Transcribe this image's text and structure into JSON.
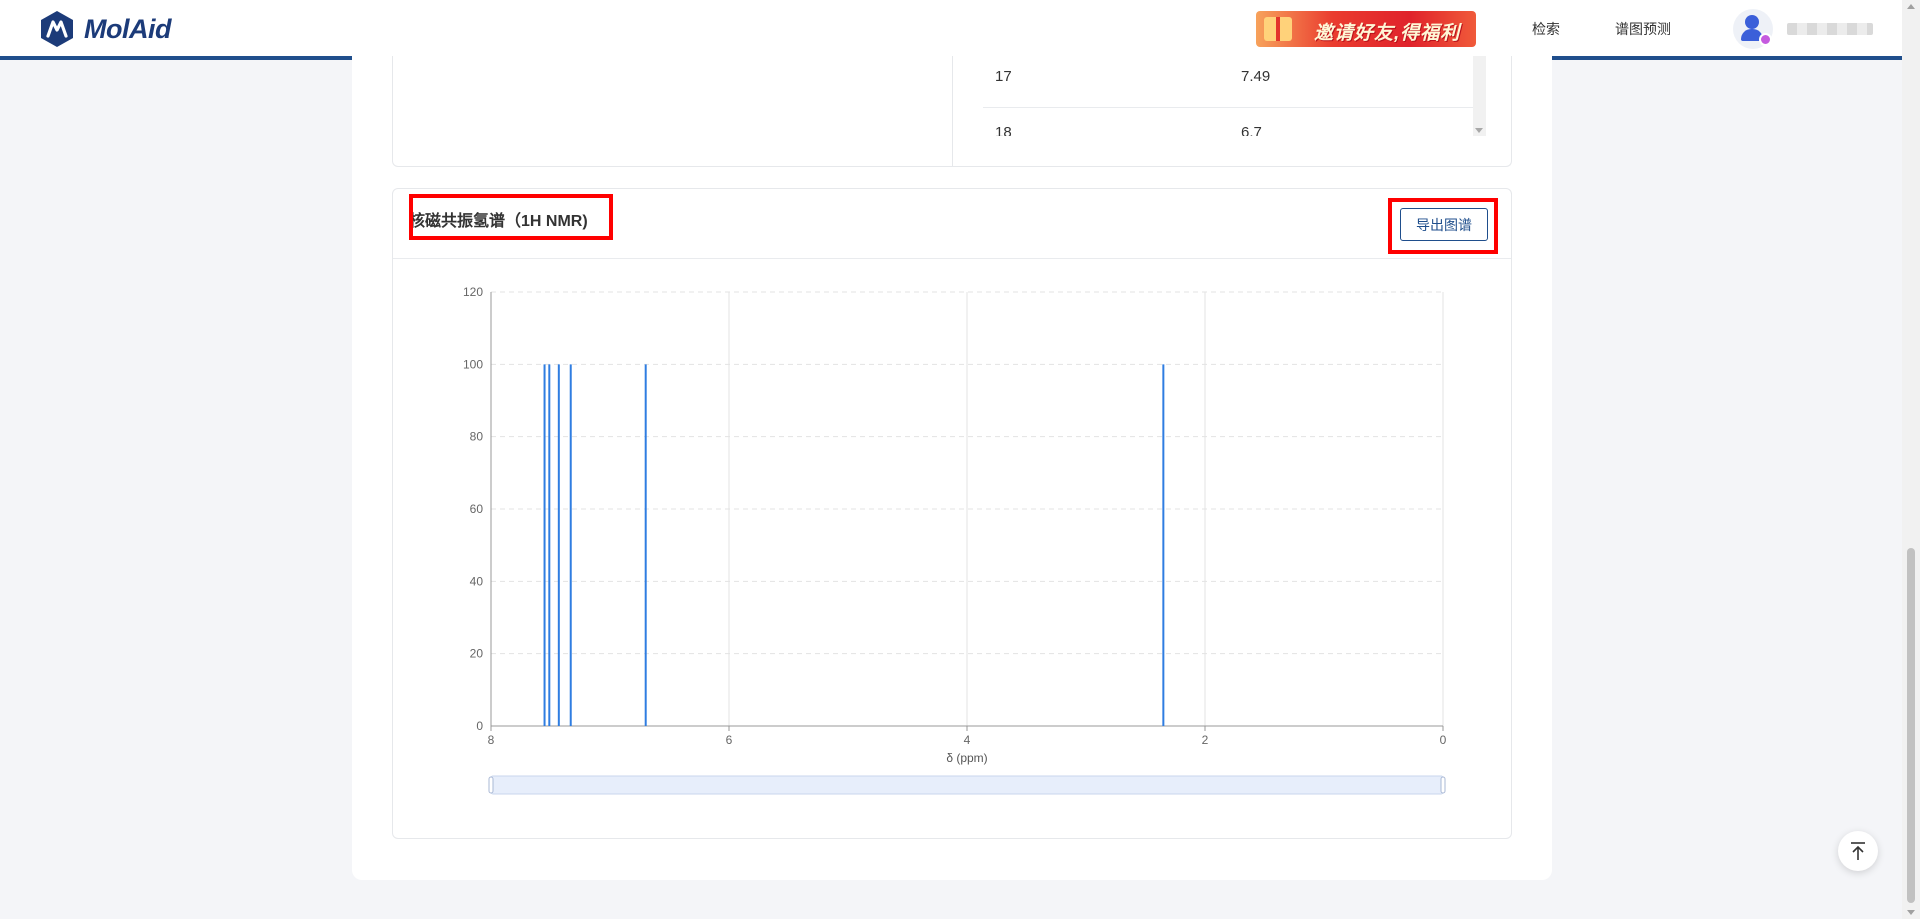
{
  "header": {
    "logo_text": "MolAid",
    "banner_text": "邀请好友,得福利",
    "nav": {
      "search": "检索",
      "predict": "谱图预测"
    }
  },
  "peak_table": {
    "rows": [
      {
        "index": "17",
        "shift": "7.49"
      },
      {
        "index": "18",
        "shift": "6.7"
      }
    ]
  },
  "nmr": {
    "title": "核磁共振氢谱（1H NMR)",
    "export_label": "导出图谱"
  },
  "colors": {
    "accent": "#1f4e8c",
    "peak": "#2f7de1",
    "highlight": "#ff0000"
  },
  "chart_data": {
    "type": "bar",
    "title": "",
    "xlabel": "δ (ppm)",
    "ylabel": "",
    "xlim": [
      8,
      0
    ],
    "ylim": [
      0,
      120
    ],
    "x_ticks": [
      8,
      6,
      4,
      2,
      0
    ],
    "y_ticks": [
      0,
      20,
      40,
      60,
      80,
      100,
      120
    ],
    "grid": true,
    "series": [
      {
        "x": [
          7.55,
          7.51,
          7.43,
          7.33,
          6.7,
          2.35
        ],
        "values": [
          100,
          100,
          100,
          100,
          100,
          100
        ]
      }
    ]
  }
}
